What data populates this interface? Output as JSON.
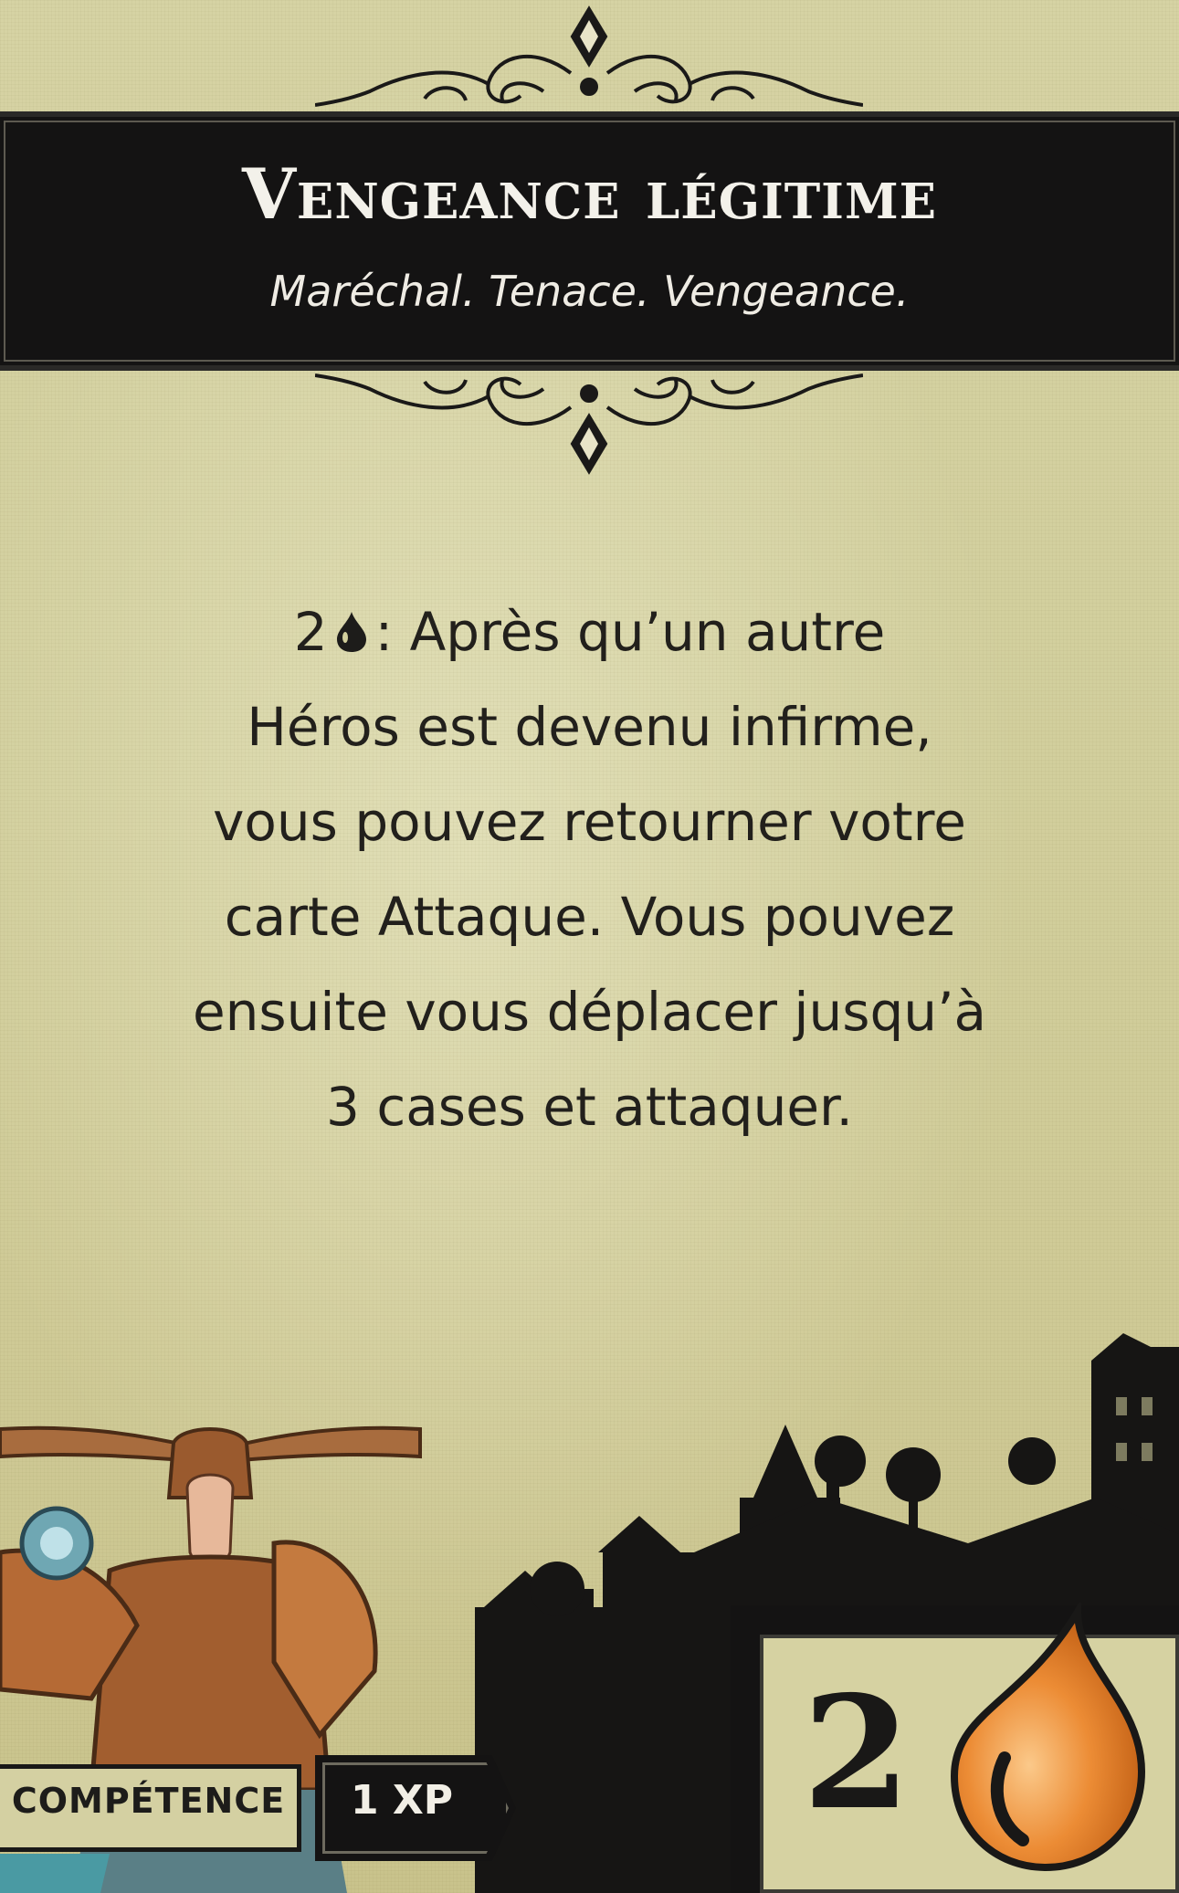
{
  "card": {
    "title": "Vengeance légitime",
    "traits": "Maréchal. Tenace. Vengeance.",
    "rules": {
      "cost_prefix": "2",
      "line1": ": Après qu’un autre",
      "line2": "Héros est devenu infirme,",
      "line3": "vous pouvez retourner votre",
      "line4": "carte Attaque. Vous pouvez",
      "line5": "ensuite vous déplacer jusqu’à",
      "line6": "3 cases et attaquer."
    },
    "type_label": "COMPÉTENCE",
    "xp_label": "1 XP",
    "cost_value": "2",
    "icons": {
      "inline_resource": "stamina-drop-icon",
      "cost_resource": "stamina-drop-icon"
    },
    "colors": {
      "parchment": "#d2cf9d",
      "band": "#141313",
      "drop": "#e98a33"
    }
  }
}
